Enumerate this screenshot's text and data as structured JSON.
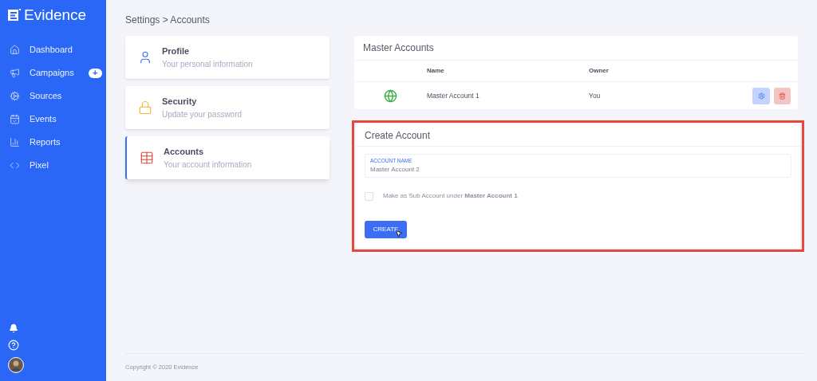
{
  "sidebar": {
    "logo": "Evidence",
    "items": [
      {
        "label": "Dashboard",
        "kind": "home",
        "selected": false
      },
      {
        "label": "Campaigns",
        "kind": "megaphone",
        "selected": false,
        "badge": "+"
      },
      {
        "label": "Sources",
        "kind": "gears",
        "selected": false
      },
      {
        "label": "Events",
        "kind": "calendar",
        "selected": false
      },
      {
        "label": "Reports",
        "kind": "chart",
        "selected": false
      },
      {
        "label": "Pixel",
        "kind": "code",
        "selected": false
      }
    ]
  },
  "breadcrumb": "Settings > Accounts",
  "settings_menu": [
    {
      "title": "Profile",
      "subtitle": "Your personal information",
      "kind": "user",
      "selected": false
    },
    {
      "title": "Security",
      "subtitle": "Update your password",
      "kind": "lock",
      "selected": false
    },
    {
      "title": "Accounts",
      "subtitle": "Your account information",
      "kind": "table",
      "selected": true
    }
  ],
  "master_accounts": {
    "title": "Master Accounts",
    "columns": [
      "Name",
      "Owner"
    ],
    "rows": [
      {
        "name": "Master Account 1",
        "owner": "You"
      }
    ]
  },
  "create_account": {
    "title": "Create Account",
    "highlighted": true,
    "field": {
      "label": "ACCOUNT NAME",
      "value": "Master Account 2"
    },
    "checkbox": {
      "label": "Make as Sub Account under **Master Account 1**",
      "checked": false
    },
    "button": "CREATE"
  },
  "footer": "Copyright © 2020 Evidence"
}
